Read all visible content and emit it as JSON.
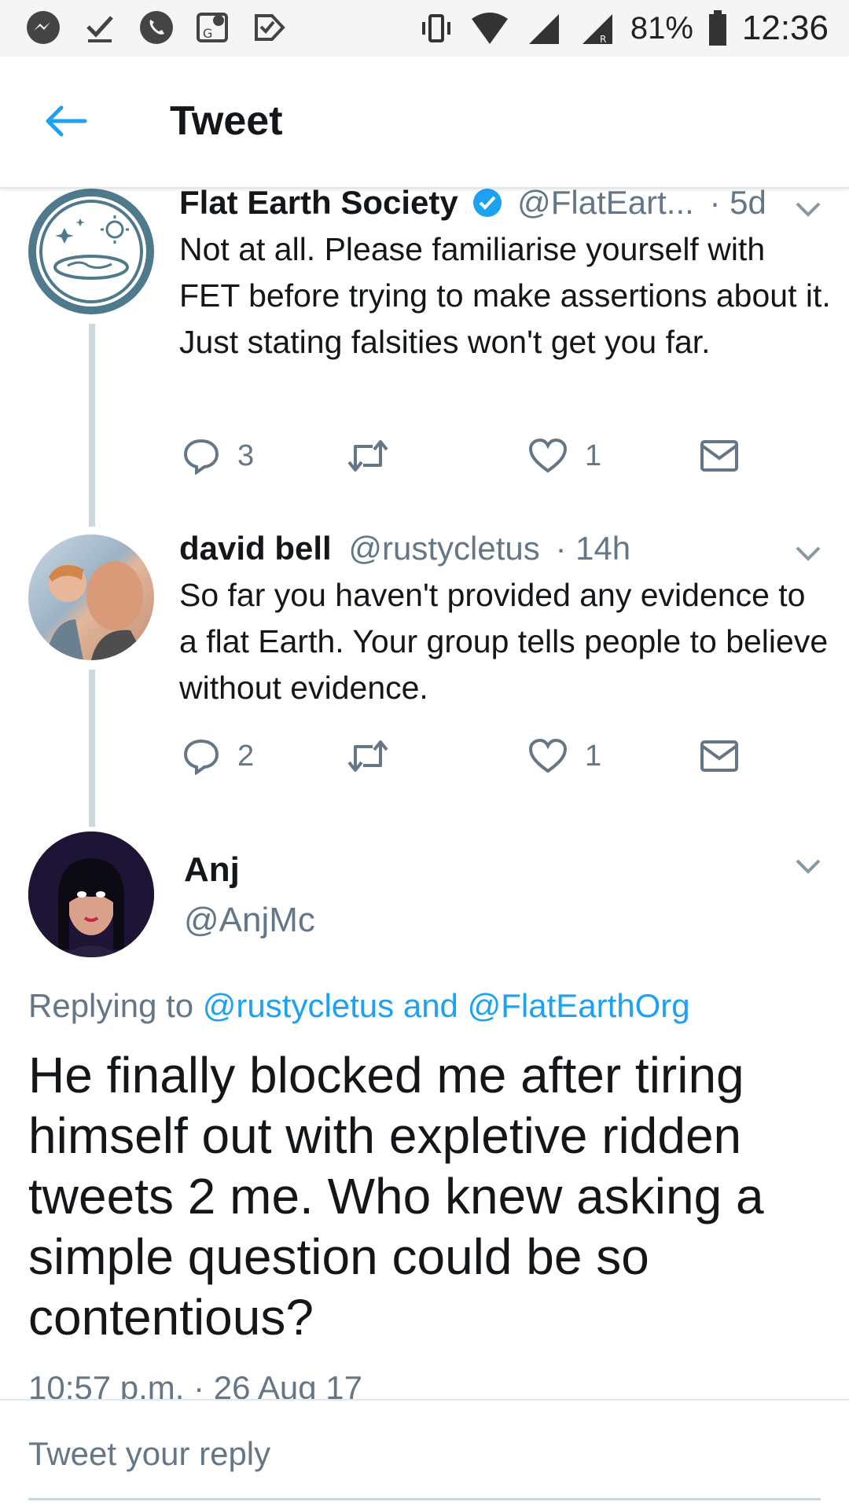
{
  "status_bar": {
    "battery": "81%",
    "time": "12:36",
    "left_icons": [
      "messenger-icon",
      "check-icon",
      "phone-icon",
      "maps-icon",
      "inbox-check-icon"
    ],
    "right_icons": [
      "vibrate-icon",
      "wifi-icon",
      "signal-icon",
      "signal-roaming-icon",
      "battery-icon"
    ]
  },
  "header": {
    "title": "Tweet",
    "back_icon": "arrow-left-icon"
  },
  "thread": [
    {
      "name": "Flat Earth Society",
      "verified": true,
      "handle": "@FlatEart...",
      "time": "· 5d",
      "text": "Not at all. Please familiarise yourself with FET before trying to make assertions about it. Just stating falsities won't get you far.",
      "replies": "3",
      "retweets": "",
      "likes": "1"
    },
    {
      "name": "david bell",
      "verified": false,
      "handle": "@rustycletus",
      "time": "· 14h",
      "text": "So far you haven't provided any evidence to a flat Earth.  Your group tells people to believe without evidence.",
      "replies": "2",
      "retweets": "",
      "likes": "1"
    }
  ],
  "main_tweet": {
    "name": "Anj",
    "handle": "@AnjMc",
    "replying_prefix": "Replying to ",
    "replying_user1": "@rustycletus",
    "replying_and": " and ",
    "replying_user2": "@FlatEarthOrg",
    "text": "He finally blocked me after tiring himself out with expletive ridden tweets 2 me. Who knew asking a simple question could be so contentious?",
    "timestamp": "10:57 p.m. · 26 Aug 17"
  },
  "reply_bar": {
    "placeholder": "Tweet your reply"
  },
  "colors": {
    "accent": "#1da1f2",
    "text": "#14171a",
    "muted": "#657786",
    "thread_line": "#ccd6dd"
  }
}
